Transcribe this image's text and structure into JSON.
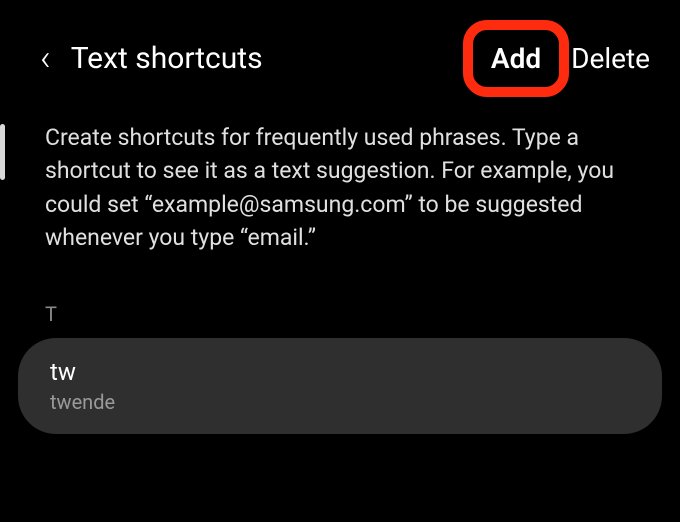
{
  "header": {
    "title": "Text shortcuts",
    "add_label": "Add",
    "delete_label": "Delete"
  },
  "description": "Create shortcuts for frequently used phrases. Type a shortcut to see it as a text suggestion. For example, you could set “example@samsung.com” to be suggested whenever you type “email.”",
  "section_letter": "T",
  "shortcuts": [
    {
      "key": "tw",
      "phrase": "twende"
    }
  ]
}
